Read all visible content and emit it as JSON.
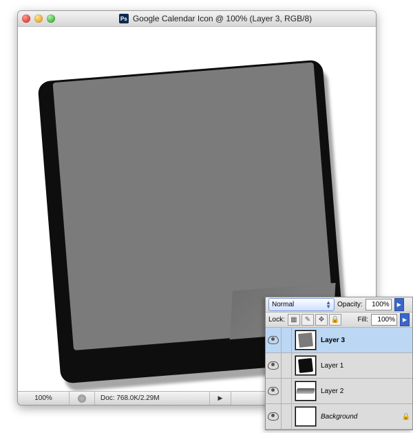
{
  "window": {
    "title": "Google Calendar Icon @ 100% (Layer 3, RGB/8)",
    "app_badge": "Ps"
  },
  "status": {
    "zoom": "100%",
    "doc_info": "Doc: 768.0K/2.29M"
  },
  "layers_panel": {
    "blend_mode": "Normal",
    "opacity_label": "Opacity:",
    "opacity_value": "100%",
    "lock_label": "Lock:",
    "fill_label": "Fill:",
    "fill_value": "100%",
    "lock_icons": [
      "transparency-lock-icon",
      "pixels-lock-icon",
      "position-lock-icon",
      "all-lock-icon"
    ],
    "layers": [
      {
        "name": "Layer 3",
        "selected": true,
        "thumb": "gray",
        "locked": false
      },
      {
        "name": "Layer 1",
        "selected": false,
        "thumb": "black",
        "locked": false
      },
      {
        "name": "Layer 2",
        "selected": false,
        "thumb": "smudge",
        "locked": false
      },
      {
        "name": "Background",
        "selected": false,
        "thumb": "bg",
        "locked": true,
        "italic": true
      }
    ]
  }
}
